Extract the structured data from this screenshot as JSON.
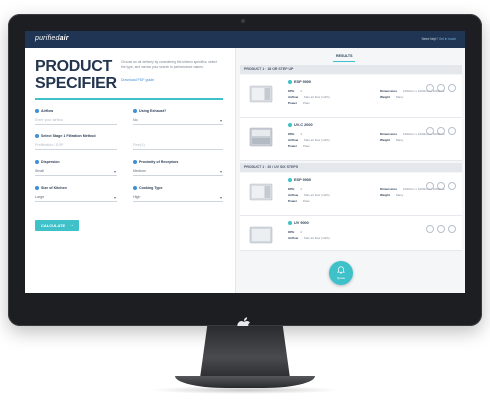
{
  "app": {
    "logo_light": "purified",
    "logo_bold": "air",
    "header_link_prefix": "Need help?",
    "header_link_text": "Get in touch"
  },
  "form": {
    "title_line1": "PRODUCT",
    "title_line2": "SPECIFIER",
    "intro": "Choose an air delivery by considering the kitchen specifics, select the type, and narrow your search to performance values.",
    "intro_link": "Download PDF guide",
    "fields": [
      {
        "label": "Airflow",
        "value": "Enter your airflow",
        "placeholder": true
      },
      {
        "label": "Using Exhaust?",
        "value": "No",
        "placeholder": false
      },
      {
        "label": "Select Stage 1 Filtration Method",
        "value": "Prefiltration / ESP",
        "placeholder": true
      },
      {
        "label": "Dispersion",
        "value": "Fine(X)",
        "placeholder": true
      },
      {
        "label": "Dispersion",
        "value": "Small",
        "placeholder": false
      },
      {
        "label": "Proximity of Receptors",
        "value": "Medium",
        "placeholder": false
      },
      {
        "label": "Size of Kitchen",
        "value": "Large",
        "placeholder": false
      },
      {
        "label": "Cooking Type",
        "value": "High",
        "placeholder": false
      }
    ],
    "calculate_label": "CALCULATE"
  },
  "results": {
    "tab_label": "RESULTS",
    "groups": [
      {
        "title": "PRODUCT 1 · 18 OR STEP UP",
        "items": [
          {
            "name": "ESP 9000",
            "specs": [
              "KPH",
              "Airflow",
              "Power"
            ],
            "values": [
              "2",
              "Max air flow (m3/h)",
              "Pass"
            ]
          },
          {
            "name": "UV-C 2000",
            "specs": [
              "KPH",
              "Airflow",
              "Power"
            ],
            "values": [
              "2",
              "Max air flow (m3/h)",
              "Pass"
            ]
          }
        ]
      },
      {
        "title": "PRODUCT 1 · 20 / UV SIX STEPS",
        "items": [
          {
            "name": "ESP 9000",
            "specs": [
              "KPH",
              "Airflow",
              "Power"
            ],
            "values": [
              "2",
              "Max air flow (m3/h)",
              "Pass"
            ]
          },
          {
            "name": "UV 9000",
            "specs": [
              "KPH",
              "Airflow",
              "Power"
            ],
            "values": [
              "2",
              "Max air flow (m3/h)",
              "Pass"
            ]
          }
        ]
      }
    ],
    "right_specs": [
      "Dimensions",
      "Weight"
    ],
    "right_values": [
      "1000mm x 1000mm x 1000mm",
      "Many"
    ],
    "fab_label": "Quote"
  },
  "colors": {
    "header_bg": "#1f3553",
    "accent": "#3fc1c9",
    "link": "#3d8fd6",
    "title": "#24364f"
  },
  "icons": [
    "apple-logo-icon",
    "edit-icon",
    "copy-icon",
    "info-icon",
    "bell-icon",
    "chevron-down-icon",
    "arrow-right-icon"
  ]
}
